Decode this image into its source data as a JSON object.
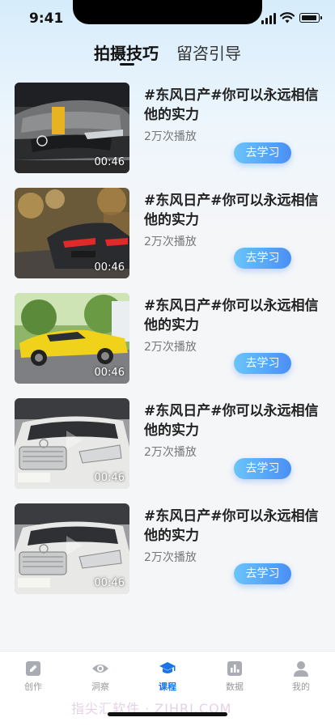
{
  "status": {
    "time": "9:41"
  },
  "tabs": [
    {
      "label": "拍摄技巧",
      "active": true
    },
    {
      "label": "留咨引导",
      "active": false
    }
  ],
  "videos": [
    {
      "title": "#东风日产#你可以永远相信他的实力",
      "plays": "2万次播放",
      "duration": "00:46",
      "button": "去学习",
      "scene": "gray-sedan-front"
    },
    {
      "title": "#东风日产#你可以永远相信他的实力",
      "plays": "2万次播放",
      "duration": "00:46",
      "button": "去学习",
      "scene": "dark-car-rear-street"
    },
    {
      "title": "#东风日产#你可以永远相信他的实力",
      "plays": "2万次播放",
      "duration": "00:46",
      "button": "去学习",
      "scene": "yellow-sports-car"
    },
    {
      "title": "#东风日产#你可以永远相信他的实力",
      "plays": "2万次播放",
      "duration": "00:46",
      "button": "去学习",
      "scene": "white-sedan-front"
    },
    {
      "title": "#东风日产#你可以永远相信他的实力",
      "plays": "2万次播放",
      "duration": "00:46",
      "button": "去学习",
      "scene": "white-sedan-front"
    }
  ],
  "tabbar": [
    {
      "label": "创作",
      "icon": "edit-icon",
      "active": false
    },
    {
      "label": "洞察",
      "icon": "eye-icon",
      "active": false
    },
    {
      "label": "课程",
      "icon": "graduation-cap-icon",
      "active": true
    },
    {
      "label": "数据",
      "icon": "chart-icon",
      "active": false
    },
    {
      "label": "我的",
      "icon": "person-icon",
      "active": false
    }
  ],
  "watermark": "指尖汇软件 · ZJHRJ.COM",
  "colors": {
    "accent": "#1a73e8",
    "button_start": "#6ac4f8",
    "button_end": "#4a8ff5"
  }
}
